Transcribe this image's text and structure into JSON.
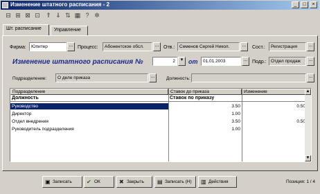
{
  "window": {
    "title": "Изменение штатного расписания - 2"
  },
  "titlebar_buttons": {
    "minimize": "_",
    "maximize": "□",
    "close": "×"
  },
  "toolbar": {
    "icons": [
      "open-icon",
      "save-icon",
      "print-icon",
      "copy-icon",
      "up-arrow-icon",
      "down-arrow-icon",
      "sort-icon",
      "grid-icon",
      "help-icon",
      "settings-icon"
    ],
    "glyphs": [
      "⊟",
      "⊞",
      "⊠",
      "⊡",
      "⇑",
      "⇓",
      "⇅",
      "▦",
      "?",
      "✲"
    ]
  },
  "tabs": [
    {
      "label": "Шт. расписание",
      "active": true
    },
    {
      "label": "Управление",
      "active": false
    }
  ],
  "form": {
    "firm_label": "Фирма:",
    "firm_value": "Юпитер",
    "process_label": "Процесс:",
    "process_value": "Абонентское обсл.",
    "resp_label": "Отв.:",
    "resp_value": "Семенов Сергей Никол.",
    "state_label": "Сост.:",
    "state_value": "Регистрация",
    "dots": "...",
    "dropdown": "▾"
  },
  "heading": {
    "title": "Изменение штатного расписания №",
    "number": "2",
    "date_label": "от",
    "date_value": "01.01.2003",
    "dept_label": "Подр.:",
    "dept_value": "Отдел продаж"
  },
  "sub_fields": {
    "division_label": "Подразделение:",
    "division_value": "О деле приказа",
    "position_label": "Должность:"
  },
  "grid": {
    "headers": [
      "Подразделение",
      "Ставок до приказа",
      "Изменение"
    ],
    "subheaders": [
      "Должность",
      "Ставок по приказу"
    ],
    "rows": [
      {
        "name": "Руководство",
        "before": "",
        "after": "3.50",
        "change": "0.50",
        "selected": true
      },
      {
        "name": "Директор",
        "before": "",
        "after": "1.00",
        "change": "",
        "selected": false
      },
      {
        "name": "Отдел внедрения",
        "before": "",
        "after": "3.50",
        "change": "0.50",
        "selected": false
      },
      {
        "name": "Руководитель подразделения",
        "before": "",
        "after": "1.00",
        "change": "",
        "selected": false
      }
    ]
  },
  "buttons": [
    {
      "label": "Записать",
      "icon": "save-icon",
      "glyph": "▣"
    },
    {
      "label": "ОК",
      "icon": "check-icon",
      "glyph": "✔"
    },
    {
      "label": "Закрыть",
      "icon": "close-icon",
      "glyph": "✖"
    },
    {
      "label": "Записать (Н)",
      "icon": "save-new-icon",
      "glyph": "▤"
    },
    {
      "label": "Действия",
      "icon": "actions-icon",
      "glyph": "▥"
    }
  ],
  "status": {
    "text": "Позиция: 1 / 4"
  }
}
